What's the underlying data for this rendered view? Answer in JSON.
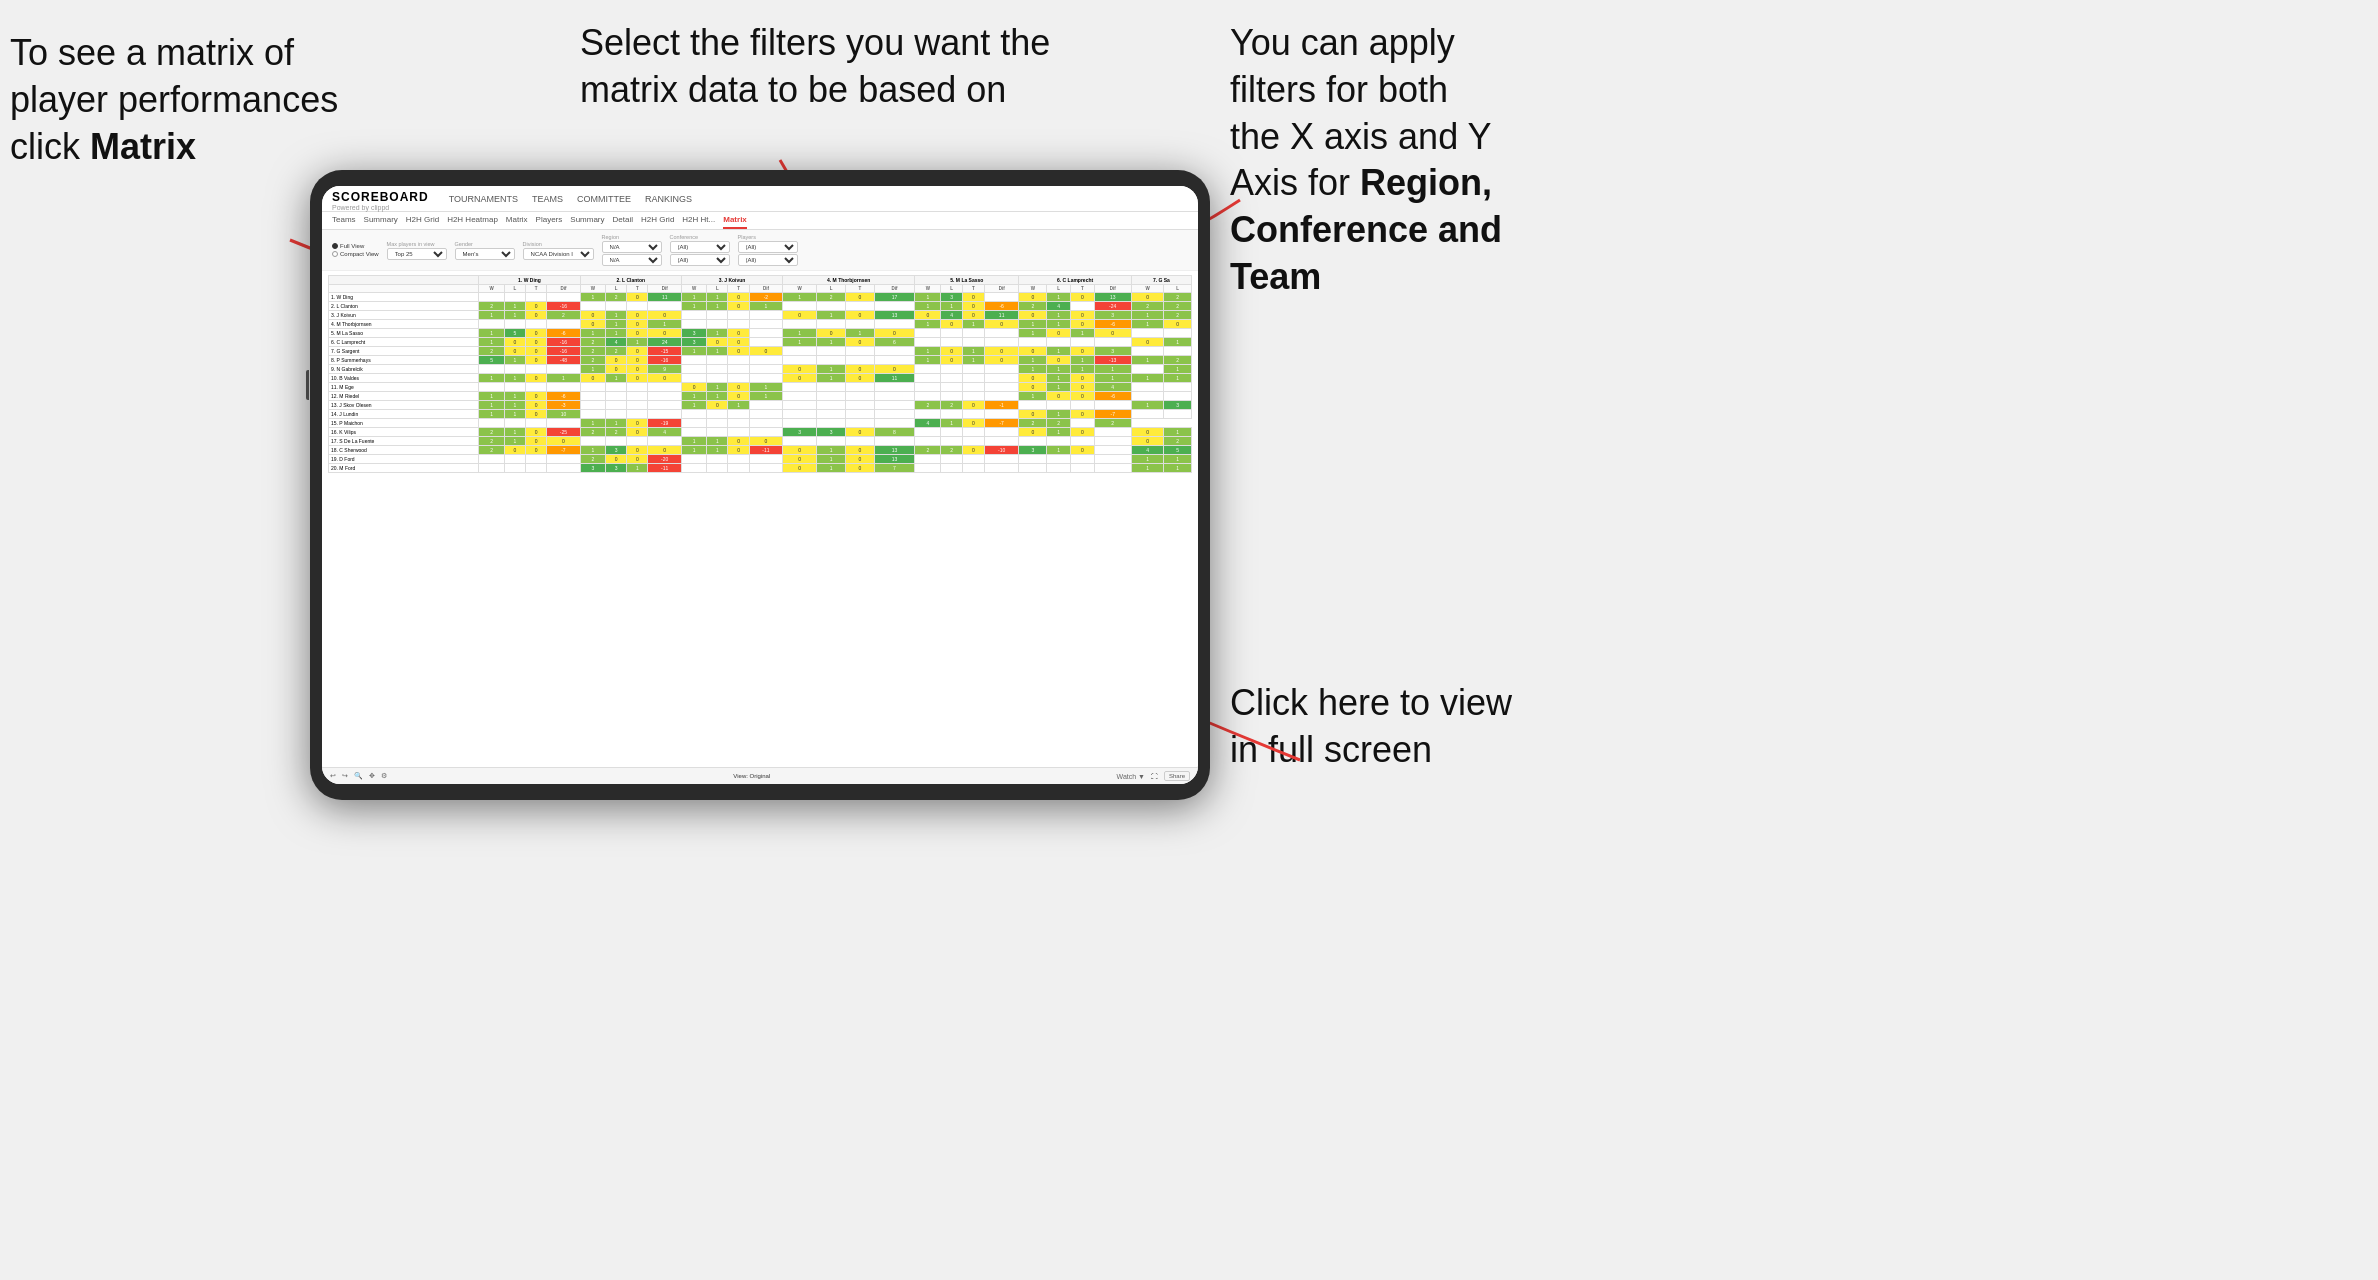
{
  "annotations": {
    "top_left": {
      "line1": "To see a matrix of",
      "line2": "player performances",
      "line3_prefix": "click ",
      "line3_bold": "Matrix"
    },
    "top_center": {
      "line1": "Select the filters you want the",
      "line2": "matrix data to be based on"
    },
    "top_right": {
      "line1": "You  can apply",
      "line2": "filters for both",
      "line3": "the X axis and Y",
      "line4_prefix": "Axis for ",
      "line4_bold": "Region,",
      "line5_bold": "Conference and",
      "line6_bold": "Team"
    },
    "bottom_right": {
      "line1": "Click here to view",
      "line2": "in full screen"
    }
  },
  "app": {
    "logo": "SCOREBOARD",
    "logo_sub": "Powered by clippd",
    "nav_items": [
      "TOURNAMENTS",
      "TEAMS",
      "COMMITTEE",
      "RANKINGS"
    ],
    "sub_tabs": [
      "Teams",
      "Summary",
      "H2H Grid",
      "H2H Heatmap",
      "Matrix",
      "Players",
      "Summary",
      "Detail",
      "H2H Grid",
      "H2H Ht...",
      "Matrix"
    ],
    "active_tab": "Matrix",
    "filters": {
      "view_options": [
        "Full View",
        "Compact View"
      ],
      "selected_view": "Full View",
      "max_players_label": "Max players in view",
      "max_players_value": "Top 25",
      "gender_label": "Gender",
      "gender_value": "Men's",
      "division_label": "Division",
      "division_value": "NCAA Division I",
      "region_label": "Region",
      "region_value": "N/A",
      "region_value2": "N/A",
      "conference_label": "Conference",
      "conference_value": "(All)",
      "conference_value2": "(All)",
      "players_label": "Players",
      "players_value": "(All)",
      "players_value2": "(All)"
    },
    "matrix": {
      "column_headers": [
        "1. W Ding",
        "2. L Clanton",
        "3. J Koivun",
        "4. M Thorbjornsen",
        "5. M La Sasso",
        "6. C Lamprecht",
        "7. G Sa"
      ],
      "sub_headers": [
        "W",
        "L",
        "T",
        "Dif"
      ],
      "rows": [
        {
          "name": "1. W Ding",
          "cells": [
            "",
            "",
            "",
            "",
            "1",
            "2",
            "0",
            "11",
            "1",
            "1",
            "0",
            "-2",
            "1",
            "2",
            "0",
            "17",
            "1",
            "3",
            "0",
            "",
            "0",
            "1",
            "0",
            "13",
            "0",
            "2"
          ]
        },
        {
          "name": "2. L Clanton",
          "cells": [
            "2",
            "1",
            "0",
            "-16",
            "",
            "",
            "",
            "",
            "1",
            "1",
            "0",
            "1",
            "",
            "",
            "",
            "",
            "1",
            "1",
            "0",
            "-6",
            "2",
            "4",
            "",
            "-24",
            "2",
            "2"
          ]
        },
        {
          "name": "3. J Koivun",
          "cells": [
            "1",
            "1",
            "0",
            "2",
            "0",
            "1",
            "0",
            "0",
            "",
            "",
            "",
            "",
            "0",
            "1",
            "0",
            "13",
            "0",
            "4",
            "0",
            "11",
            "0",
            "1",
            "0",
            "3",
            "1",
            "2"
          ]
        },
        {
          "name": "4. M Thorbjornsen",
          "cells": [
            "",
            "",
            "",
            "",
            "0",
            "1",
            "0",
            "1",
            "",
            "",
            "",
            "",
            "",
            "",
            "",
            "",
            "1",
            "0",
            "1",
            "0",
            "1",
            "1",
            "0",
            "-6",
            "1",
            "0"
          ]
        },
        {
          "name": "5. M La Sasso",
          "cells": [
            "1",
            "5",
            "0",
            "-6",
            "1",
            "1",
            "0",
            "0",
            "3",
            "1",
            "0",
            "",
            "1",
            "0",
            "1",
            "0",
            "",
            "",
            "",
            "",
            "1",
            "0",
            "1",
            "0",
            "",
            ""
          ]
        },
        {
          "name": "6. C Lamprecht",
          "cells": [
            "1",
            "0",
            "0",
            "-16",
            "2",
            "4",
            "1",
            "24",
            "3",
            "0",
            "0",
            "",
            "1",
            "1",
            "0",
            "6",
            "",
            "",
            "",
            "",
            "",
            "",
            "",
            "",
            "0",
            "1"
          ]
        },
        {
          "name": "7. G Sargent",
          "cells": [
            "2",
            "0",
            "0",
            "-16",
            "2",
            "2",
            "0",
            "-15",
            "1",
            "1",
            "0",
            "0",
            "",
            "",
            "",
            "",
            "1",
            "0",
            "1",
            "0",
            "0",
            "1",
            "0",
            "3",
            "",
            ""
          ]
        },
        {
          "name": "8. P Summerhays",
          "cells": [
            "5",
            "1",
            "0",
            "-48",
            "2",
            "0",
            "0",
            "-16",
            "",
            "",
            "",
            "",
            "",
            "",
            "",
            "",
            "1",
            "0",
            "1",
            "0",
            "1",
            "0",
            "1",
            "-13",
            "1",
            "2"
          ]
        },
        {
          "name": "9. N Gabrelcik",
          "cells": [
            "",
            "",
            "",
            "",
            "1",
            "0",
            "0",
            "9",
            "",
            "",
            "",
            "",
            "0",
            "1",
            "0",
            "0",
            "",
            "",
            "",
            "",
            "1",
            "1",
            "1",
            "1",
            "",
            "1"
          ]
        },
        {
          "name": "10. B Valdes",
          "cells": [
            "1",
            "1",
            "0",
            "1",
            "0",
            "1",
            "0",
            "0",
            "",
            "",
            "",
            "",
            "0",
            "1",
            "0",
            "11",
            "",
            "",
            "",
            "",
            "0",
            "1",
            "0",
            "1",
            "1",
            "1"
          ]
        },
        {
          "name": "11. M Ege",
          "cells": [
            "",
            "",
            "",
            "",
            "",
            "",
            "",
            "",
            "0",
            "1",
            "0",
            "1",
            "",
            "",
            "",
            "",
            "",
            "",
            "",
            "",
            "0",
            "1",
            "0",
            "4",
            "",
            ""
          ]
        },
        {
          "name": "12. M Riedel",
          "cells": [
            "1",
            "1",
            "0",
            "-6",
            "",
            "",
            "",
            "",
            "1",
            "1",
            "0",
            "1",
            "",
            "",
            "",
            "",
            "",
            "",
            "",
            "",
            "1",
            "0",
            "0",
            "-6",
            "",
            ""
          ]
        },
        {
          "name": "13. J Skov Olesen",
          "cells": [
            "1",
            "1",
            "0",
            "-3",
            "",
            "",
            "",
            "",
            "1",
            "0",
            "1",
            "",
            "",
            "",
            "",
            "",
            "2",
            "2",
            "0",
            "-1",
            "",
            "",
            "",
            "",
            "1",
            "3"
          ]
        },
        {
          "name": "14. J Lundin",
          "cells": [
            "1",
            "1",
            "0",
            "10",
            "",
            "",
            "",
            "",
            "",
            "",
            "",
            "",
            "",
            "",
            "",
            "",
            "",
            "",
            "",
            "",
            "0",
            "1",
            "0",
            "-7",
            "",
            ""
          ]
        },
        {
          "name": "15. P Maichon",
          "cells": [
            "",
            "",
            "",
            "",
            "1",
            "1",
            "0",
            "-19",
            "",
            "",
            "",
            "",
            "",
            "",
            "",
            "",
            "4",
            "1",
            "0",
            "-7",
            "2",
            "2",
            "",
            "2"
          ]
        },
        {
          "name": "16. K Vilips",
          "cells": [
            "2",
            "1",
            "0",
            "-25",
            "2",
            "2",
            "0",
            "4",
            "",
            "",
            "",
            "",
            "3",
            "3",
            "0",
            "8",
            "",
            "",
            "",
            "",
            "0",
            "1",
            "0",
            "",
            "0",
            "1"
          ]
        },
        {
          "name": "17. S De La Fuente",
          "cells": [
            "2",
            "1",
            "0",
            "0",
            "",
            "",
            "",
            "",
            "1",
            "1",
            "0",
            "0",
            "",
            "",
            "",
            "",
            "",
            "",
            "",
            "",
            "",
            "",
            "",
            "",
            "0",
            "2"
          ]
        },
        {
          "name": "18. C Sherwood",
          "cells": [
            "2",
            "0",
            "0",
            "-7",
            "1",
            "3",
            "0",
            "0",
            "1",
            "1",
            "0",
            "-11",
            "0",
            "1",
            "0",
            "13",
            "2",
            "2",
            "0",
            "-10",
            "3",
            "1",
            "0",
            "",
            "4",
            "5"
          ]
        },
        {
          "name": "19. D Ford",
          "cells": [
            "",
            "",
            "",
            "",
            "2",
            "0",
            "0",
            "-20",
            "",
            "",
            "",
            "",
            "0",
            "1",
            "0",
            "13",
            "",
            "",
            "",
            "",
            "",
            "",
            "",
            "",
            "1",
            "1"
          ]
        },
        {
          "name": "20. M Ford",
          "cells": [
            "",
            "",
            "",
            "",
            "3",
            "3",
            "1",
            "-11",
            "",
            "",
            "",
            "",
            "0",
            "1",
            "0",
            "7",
            "",
            "",
            "",
            "",
            "",
            "",
            "",
            "",
            "1",
            "1"
          ]
        }
      ]
    },
    "toolbar": {
      "undo": "↩",
      "redo": "↪",
      "zoom": "🔍",
      "pan": "✥",
      "settings": "⚙",
      "view_label": "View: Original",
      "watch": "Watch ▼",
      "share": "Share"
    }
  }
}
